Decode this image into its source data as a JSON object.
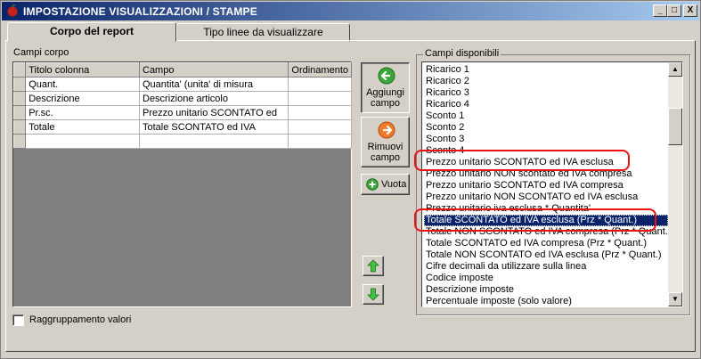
{
  "window": {
    "title": "IMPOSTAZIONE VISUALIZZAZIONI / STAMPE",
    "minimize": "_",
    "maximize": "□",
    "close": "X"
  },
  "tabs": [
    {
      "label": "Corpo del report",
      "active": true
    },
    {
      "label": "Tipo linee da visualizzare",
      "active": false
    }
  ],
  "left": {
    "section_label": "Campi corpo",
    "columns": [
      "Titolo colonna",
      "Campo",
      "Ordinamento"
    ],
    "rows": [
      {
        "titolo": "Quant.",
        "campo": "Quantita' (unita' di misura",
        "ordinamento": ""
      },
      {
        "titolo": "Descrizione",
        "campo": "Descrizione articolo",
        "ordinamento": ""
      },
      {
        "titolo": "Pr.sc.",
        "campo": "Prezzo unitario SCONTATO ed",
        "ordinamento": ""
      },
      {
        "titolo": "Totale",
        "campo": "Totale SCONTATO ed IVA",
        "ordinamento": ""
      },
      {
        "titolo": "",
        "campo": "",
        "ordinamento": ""
      }
    ],
    "checkbox_label": "Raggruppamento valori",
    "checkbox_checked": false
  },
  "buttons": {
    "add_line1": "Aggiungi",
    "add_line2": "campo",
    "remove_line1": "Rimuovi",
    "remove_line2": "campo",
    "empty": "Vuota",
    "up_icon": "arrow-up-icon",
    "down_icon": "arrow-down-icon"
  },
  "right": {
    "group_label": "Campi disponibili",
    "items": [
      "Ricarico 1",
      "Ricarico 2",
      "Ricarico 3",
      "Ricarico 4",
      "Sconto 1",
      "Sconto 2",
      "Sconto 3",
      "Sconto 4",
      "Prezzo unitario SCONTATO ed IVA esclusa",
      "Prezzo unitario NON scontato ed IVA compresa",
      "Prezzo unitario SCONTATO ed IVA compresa",
      "Prezzo unitario NON SCONTATO ed IVA esclusa",
      "Prezzo unitario iva esclusa * Quantita'",
      "Totale SCONTATO ed IVA esclusa (Prz * Quant.)",
      "Totale NON SCONTATO ed IVA compresa (Prz * Quant.)",
      "Totale SCONTATO ed IVA compresa (Prz * Quant.)",
      "Totale NON SCONTATO ed IVA esclusa (Prz * Quant.)",
      "Cifre decimali da utilizzare sulla linea",
      "Codice imposte",
      "Descrizione imposte",
      "Percentuale imposte (solo valore)"
    ],
    "selected_index": 13
  },
  "colors": {
    "titlebar_start": "#0a246a",
    "titlebar_end": "#a6caf0",
    "selection": "#0a246a",
    "annotation_red": "#ee1111",
    "green_icon": "#3aa63a",
    "orange_icon": "#f07a2a"
  }
}
